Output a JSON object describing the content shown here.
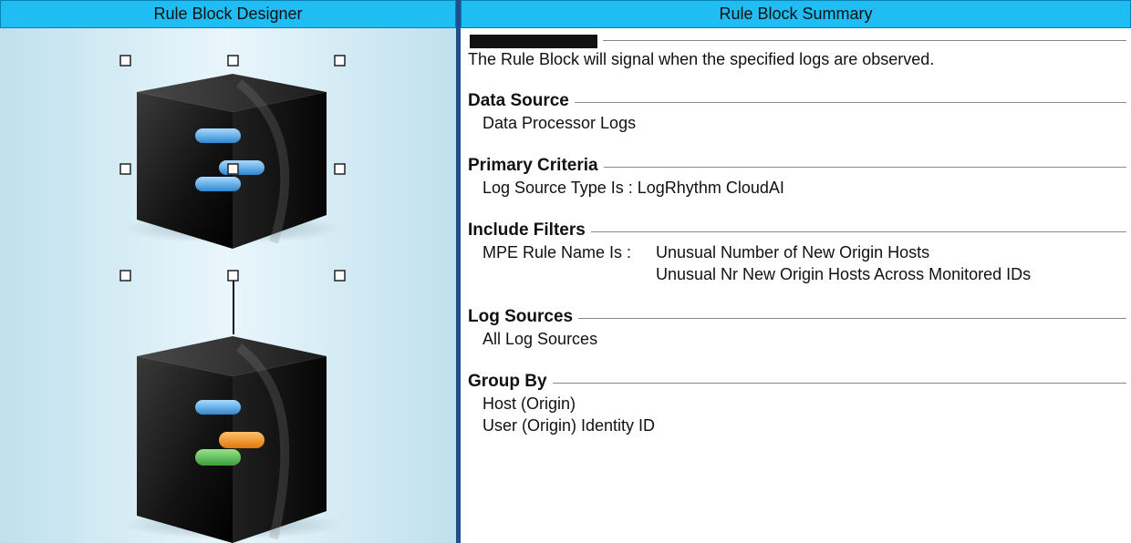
{
  "left_pane": {
    "title": "Rule Block Designer"
  },
  "right_pane": {
    "title": "Rule Block Summary",
    "description": "The Rule Block will signal when the specified logs are observed.",
    "sections": {
      "data_source": {
        "title": "Data Source",
        "items": [
          "Data Processor Logs"
        ]
      },
      "primary_criteria": {
        "title": "Primary Criteria",
        "items": [
          "Log Source Type Is : LogRhythm CloudAI"
        ]
      },
      "include_filters": {
        "title": "Include Filters",
        "label": "MPE Rule Name Is :",
        "values": [
          "Unusual Number of New Origin Hosts",
          "Unusual Nr New Origin Hosts Across Monitored IDs"
        ]
      },
      "log_sources": {
        "title": "Log Sources",
        "items": [
          "All Log Sources"
        ]
      },
      "group_by": {
        "title": "Group By",
        "items": [
          "Host (Origin)",
          "User (Origin) Identity ID"
        ]
      }
    }
  },
  "colors": {
    "header_bg": "#1fbdf2",
    "pane_border": "#1f4f8c",
    "pill_blue": "#4aa3e0",
    "pill_orange": "#f08a1c",
    "pill_green": "#4bb84a"
  }
}
